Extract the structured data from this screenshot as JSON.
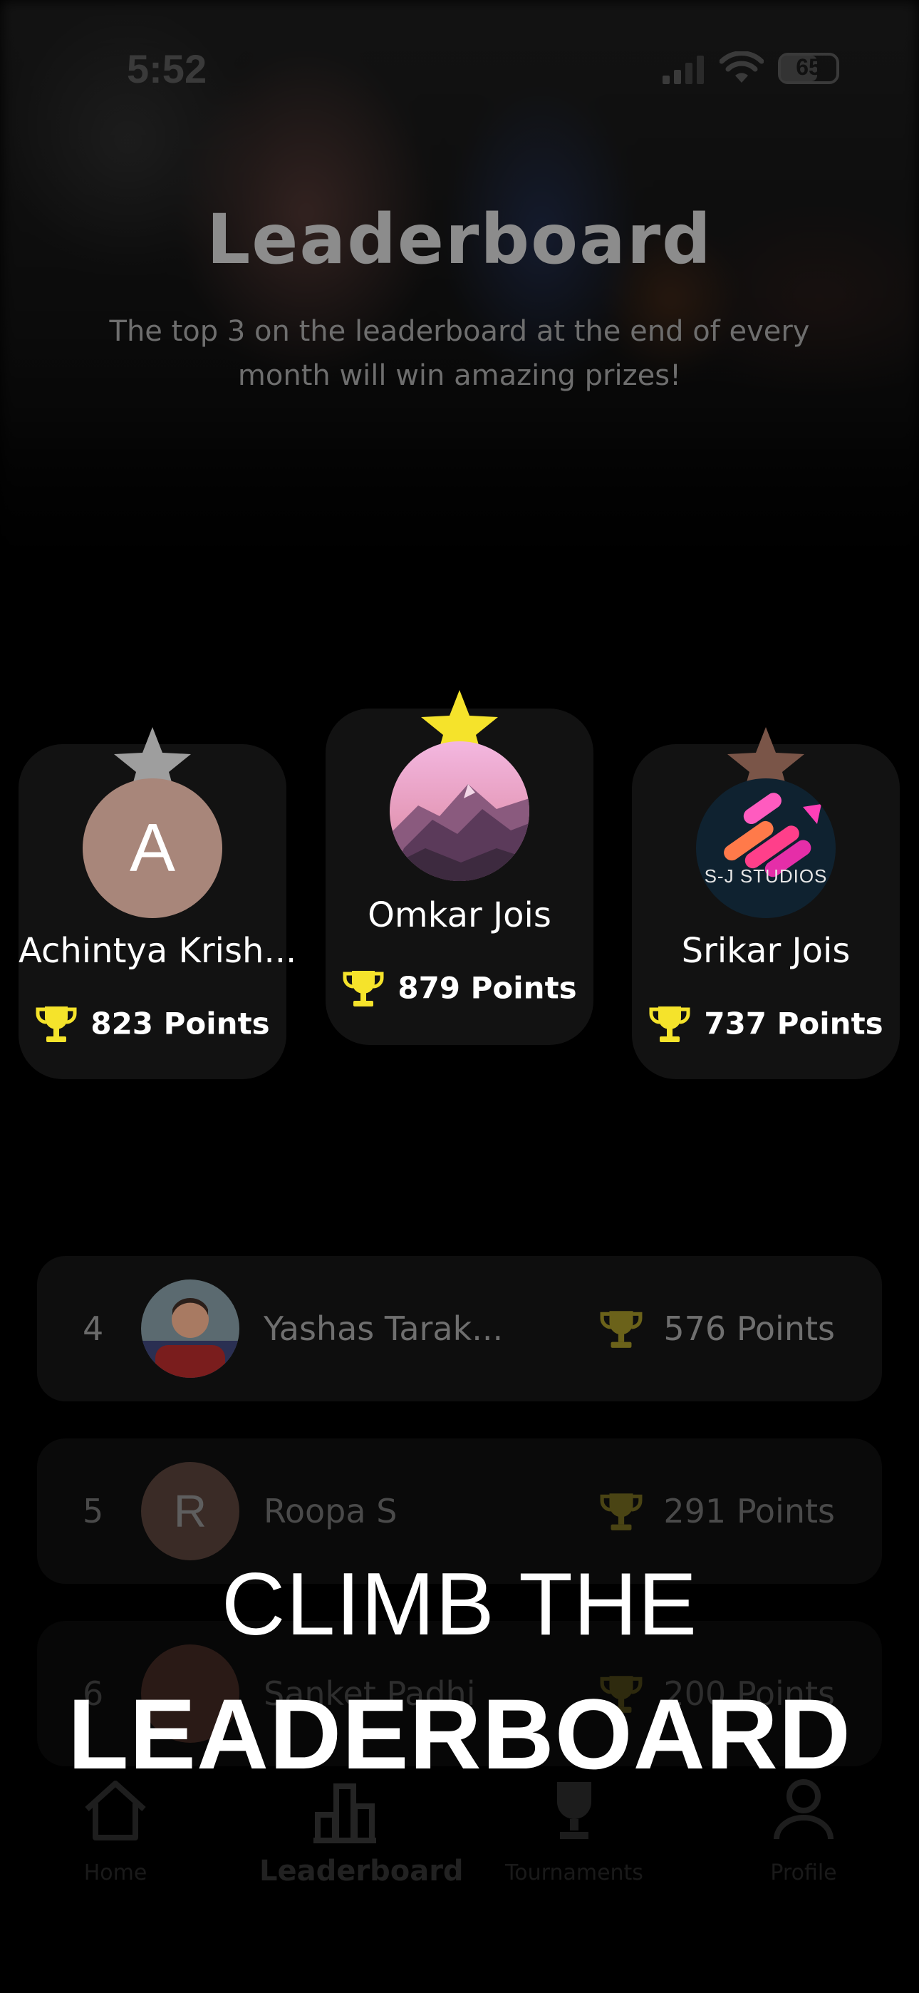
{
  "status_bar": {
    "time": "5:52",
    "battery": "65"
  },
  "header": {
    "title": "Leaderboard",
    "subtitle": "The top 3 on the leaderboard at the end of every month will win amazing prizes!"
  },
  "podium": [
    {
      "place": 2,
      "name": "Achintya Krish...",
      "points": "823 Points",
      "avatar_letter": "A",
      "avatar_color": "#a8867a",
      "star_color": "#9e9e9e"
    },
    {
      "place": 1,
      "name": "Omkar Jois",
      "points": "879 Points",
      "avatar_image": "mountain-photo",
      "star_color": "#f5e32b"
    },
    {
      "place": 3,
      "name": "Srikar Jois",
      "points": "737 Points",
      "avatar_image": "sj-studios-logo",
      "avatar_logo_text": "S-J STUDIOS",
      "star_color": "#7a5548"
    }
  ],
  "list": [
    {
      "rank": "4",
      "name": "Yashas Tarak...",
      "points": "576 Points",
      "avatar_image": "player-photo"
    },
    {
      "rank": "5",
      "name": "Roopa S",
      "points": "291 Points",
      "avatar_letter": "R"
    },
    {
      "rank": "6",
      "name": "Sanket Padhi",
      "points": "200 Points",
      "avatar_image": "photo"
    }
  ],
  "nav": [
    {
      "label": "Home",
      "icon": "home-icon"
    },
    {
      "label": "Leaderboard",
      "icon": "bar-chart-icon",
      "active": true
    },
    {
      "label": "Tournaments",
      "icon": "trophy-icon"
    },
    {
      "label": "Profile",
      "icon": "person-icon"
    }
  ],
  "overlay": {
    "line1": "CLIMB THE",
    "line2": "LEADERBOARD"
  },
  "colors": {
    "gold": "#f5e32b",
    "background": "#000000",
    "card": "#121212"
  }
}
